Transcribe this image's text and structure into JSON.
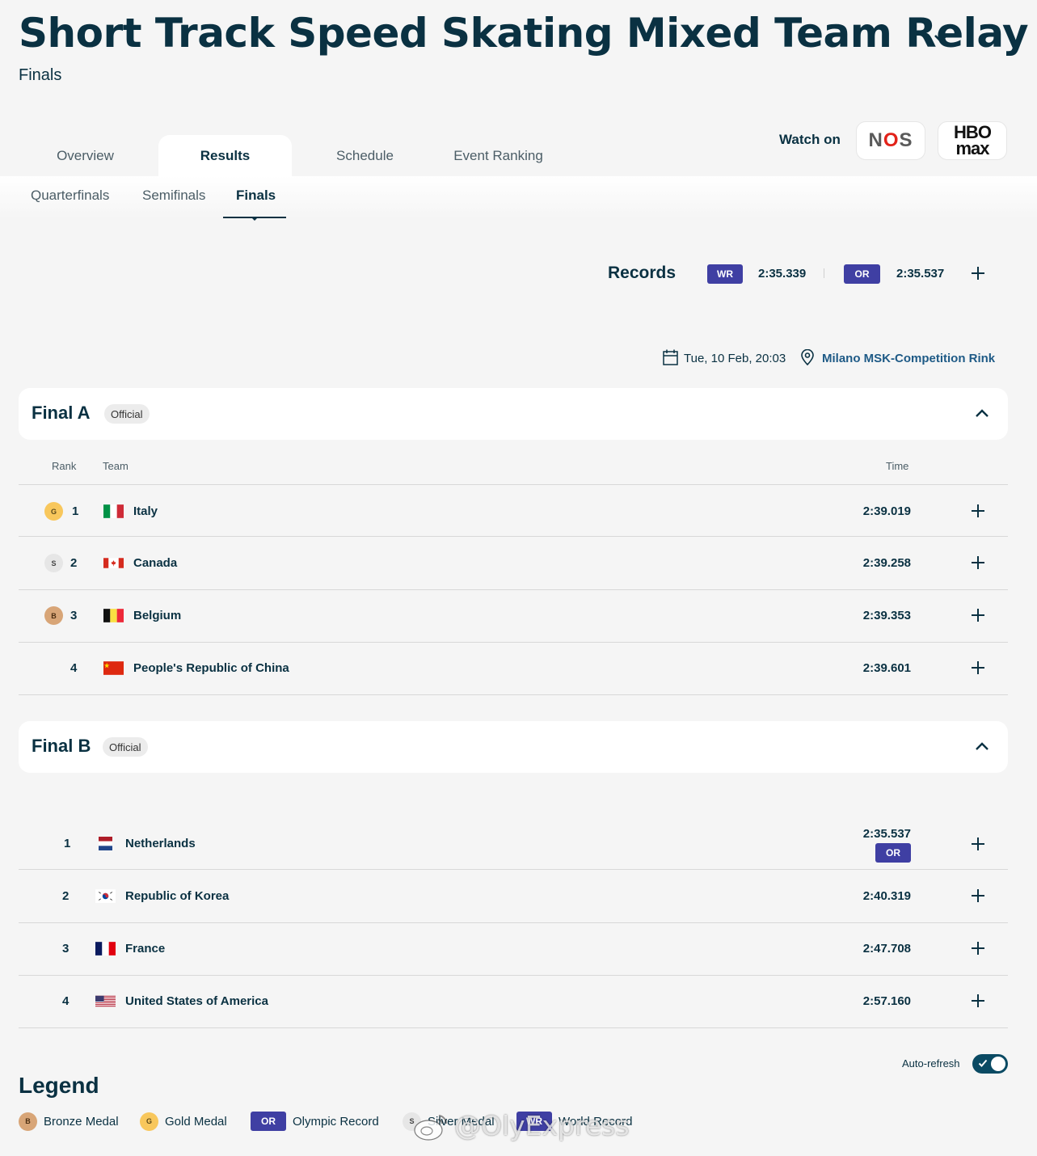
{
  "header": {
    "title": "Short Track Speed Skating Mixed Team Relay",
    "subtitle": "Finals"
  },
  "tabs": [
    {
      "label": "Overview"
    },
    {
      "label": "Results"
    },
    {
      "label": "Schedule"
    },
    {
      "label": "Event Ranking"
    }
  ],
  "watch": {
    "label": "Watch on",
    "nos_logo": "NOS",
    "hbo_line1": "HBO",
    "hbo_line2": "max"
  },
  "subtabs": [
    {
      "label": "Quarterfinals"
    },
    {
      "label": "Semifinals"
    },
    {
      "label": "Finals"
    }
  ],
  "records": {
    "label": "Records",
    "wr_badge": "WR",
    "wr_value": "2:35.339",
    "or_badge": "OR",
    "or_value": "2:35.537"
  },
  "event_info": {
    "datetime": "Tue, 10 Feb, 20:03",
    "venue": "Milano MSK-Competition Rink"
  },
  "final_a": {
    "title": "Final A",
    "status": "Official",
    "columns": {
      "rank": "Rank",
      "team": "Team",
      "time": "Time"
    },
    "rows": [
      {
        "medal": "G",
        "rank": "1",
        "team": "Italy",
        "time": "2:39.019"
      },
      {
        "medal": "S",
        "rank": "2",
        "team": "Canada",
        "time": "2:39.258"
      },
      {
        "medal": "B",
        "rank": "3",
        "team": "Belgium",
        "time": "2:39.353"
      },
      {
        "medal": "",
        "rank": "4",
        "team": "People's Republic of China",
        "time": "2:39.601"
      }
    ]
  },
  "final_b": {
    "title": "Final B",
    "status": "Official",
    "rows": [
      {
        "rank": "1",
        "team": "Netherlands",
        "time": "2:35.537",
        "record": "OR"
      },
      {
        "rank": "2",
        "team": "Republic of Korea",
        "time": "2:40.319"
      },
      {
        "rank": "3",
        "team": "France",
        "time": "2:47.708"
      },
      {
        "rank": "4",
        "team": "United States of America",
        "time": "2:57.160"
      }
    ]
  },
  "auto_refresh": {
    "label": "Auto-refresh",
    "enabled": true
  },
  "legend": {
    "title": "Legend",
    "items": [
      {
        "badge": "B",
        "label": "Bronze Medal"
      },
      {
        "badge": "G",
        "label": "Gold Medal"
      },
      {
        "badge": "OR",
        "label": "Olympic Record"
      },
      {
        "badge": "S",
        "label": "Silver Medal"
      },
      {
        "badge": "WR",
        "label": "World Record"
      }
    ]
  },
  "watermark": "@OlyExpress",
  "colors": {
    "primary": "#0a3142",
    "record_badge": "#3f3fa3",
    "gold": "#f8c75c",
    "silver": "#e6e6e6",
    "bronze": "#d8a577",
    "venue_link": "#1e5a86"
  }
}
